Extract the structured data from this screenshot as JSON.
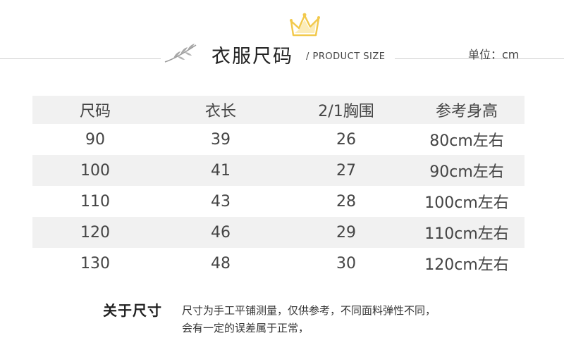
{
  "header": {
    "title": "衣服尺码",
    "subtitle": "/ PRODUCT  SIZE",
    "unit": "单位：cm",
    "accent_color": "#f5d36a",
    "icons": [
      "wheat-icon",
      "crown-icon"
    ]
  },
  "table": {
    "columns": [
      "尺码",
      "衣长",
      "2/1胸围",
      "参考身高"
    ],
    "rows": [
      [
        "90",
        "39",
        "26",
        "80cm左右"
      ],
      [
        "100",
        "41",
        "27",
        "90cm左右"
      ],
      [
        "110",
        "43",
        "28",
        "100cm左右"
      ],
      [
        "120",
        "46",
        "29",
        "110cm左右"
      ],
      [
        "130",
        "48",
        "30",
        "120cm左右"
      ]
    ]
  },
  "note": {
    "label": "关于尺寸",
    "line1": "尺寸为手工平铺测量，仅供参考，不同面料弹性不同，",
    "line2": "会有一定的误差属于正常，"
  }
}
